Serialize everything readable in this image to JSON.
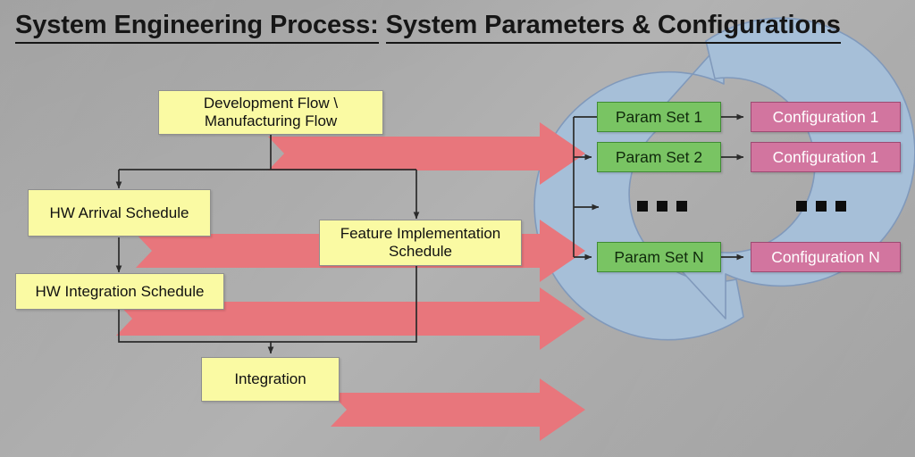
{
  "title": {
    "line1": "System Engineering Process:",
    "line2": "System Parameters & Configurations"
  },
  "colors": {
    "background": "#a9a9a9",
    "yellow_box": "#fafaa3",
    "green_box": "#79c463",
    "green_border": "#3f8b34",
    "pink_box": "#d2759f",
    "pink_border": "#9d4a72",
    "cycle_arrow_blue": "#a6bfd8",
    "cycle_arrow_border": "#7f9cc0",
    "wide_arrow_red": "#e8767c",
    "connector_line": "#2b2b2b",
    "text_dark": "#111111",
    "text_light": "#ffffff"
  },
  "flow": {
    "nodes": [
      {
        "id": "development-flow",
        "label": "Development Flow \\\nManufacturing Flow"
      },
      {
        "id": "hw-arrival-schedule",
        "label": "HW Arrival Schedule"
      },
      {
        "id": "hw-integration-schedule",
        "label": "HW Integration Schedule"
      },
      {
        "id": "feature-implementation-schedule",
        "label": "Feature Implementation\nSchedule"
      },
      {
        "id": "integration",
        "label": "Integration"
      }
    ],
    "node_labels": {
      "development_flow_l1": "Development Flow \\",
      "development_flow_l2": "Manufacturing Flow",
      "hw_arrival": "HW Arrival Schedule",
      "hw_integration": "HW Integration Schedule",
      "feature_impl_l1": "Feature Implementation",
      "feature_impl_l2": "Schedule",
      "integration": "Integration"
    }
  },
  "cycle": {
    "param_sets": [
      {
        "label": "Param Set 1"
      },
      {
        "label": "Param Set 2"
      },
      {
        "label": "Param Set N"
      }
    ],
    "configurations": [
      {
        "label": "Configuration 1"
      },
      {
        "label": "Configuration 1"
      },
      {
        "label": "Configuration N"
      }
    ],
    "ellipsis_count": 3
  },
  "wide_arrows": {
    "count": 4,
    "direction": "right"
  }
}
